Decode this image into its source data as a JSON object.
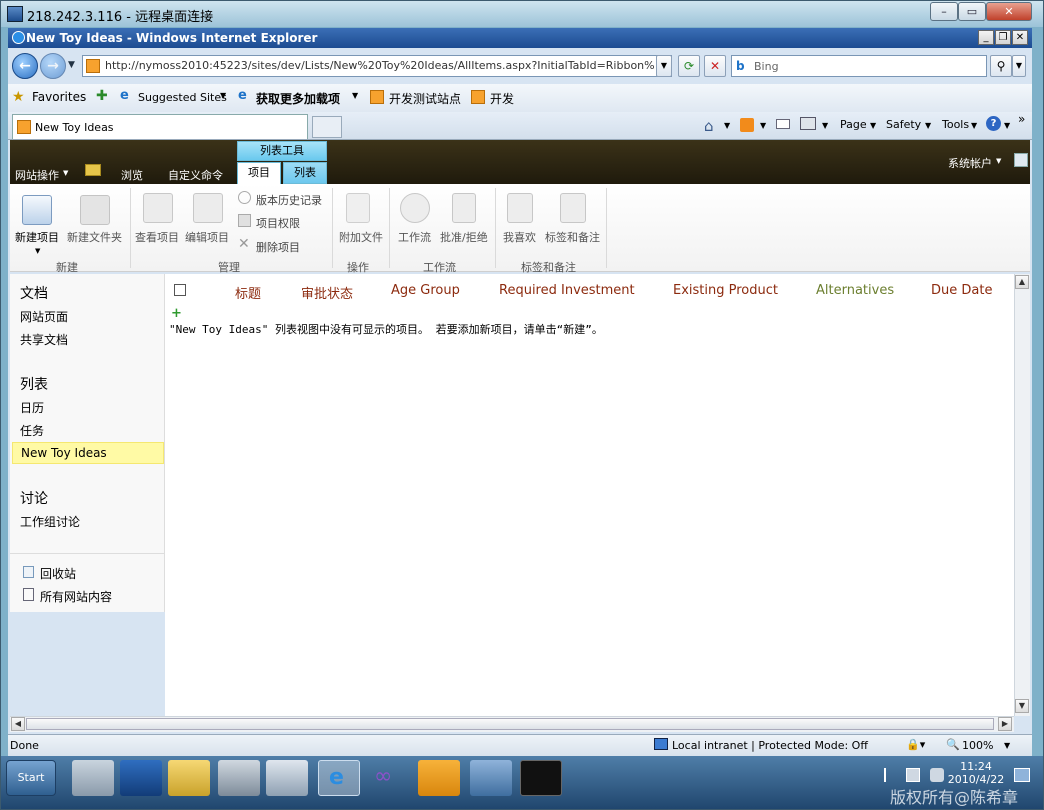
{
  "rdp": {
    "title": "218.242.3.116 - 远程桌面连接"
  },
  "ie": {
    "title": "New Toy Ideas - Windows Internet Explorer",
    "address": "http://nymoss2010:45223/sites/dev/Lists/New%20Toy%20Ideas/AllItems.aspx?InitialTabId=Ribbon%2EListItem&",
    "search_placeholder": "Bing",
    "favorites": {
      "label": "Favorites",
      "suggested": "Suggested Sites",
      "more_addons": "获取更多加载项",
      "dev_site": "开发测试站点",
      "dev": "开发"
    },
    "tab_label": "New Toy Ideas",
    "commands": {
      "page": "Page",
      "safety": "Safety",
      "tools": "Tools"
    }
  },
  "sharepoint": {
    "site_actions": "网站操作",
    "browse": "浏览",
    "custom_commands": "自定义命令",
    "context_group": "列表工具",
    "tab_items": "项目",
    "tab_list": "列表",
    "user": "系统帐户",
    "ribbon": {
      "new_item": "新建项目",
      "new_folder": "新建文件夹",
      "view_item": "查看项目",
      "edit_item": "编辑项目",
      "version_history": "版本历史记录",
      "item_permissions": "项目权限",
      "delete_item": "删除项目",
      "attach_file": "附加文件",
      "workflows": "工作流",
      "approve_reject": "批准/拒绝",
      "i_like_it": "我喜欢",
      "tags_notes": "标签和备注",
      "groups": {
        "new": "新建",
        "manage": "管理",
        "actions": "操作",
        "workflow": "工作流",
        "tags": "标签和备注"
      }
    },
    "leftnav": {
      "documents": "文档",
      "site_pages": "网站页面",
      "shared_documents": "共享文档",
      "lists": "列表",
      "calendar": "日历",
      "tasks": "任务",
      "new_toy_ideas": "New Toy Ideas",
      "discussions": "讨论",
      "team_discussion": "工作组讨论",
      "recycle_bin": "回收站",
      "all_content": "所有网站内容"
    },
    "columns": [
      "标题",
      "审批状态",
      "Age Group",
      "Required Investment",
      "Existing Product",
      "Alternatives",
      "Due Date"
    ],
    "empty_message": "\"New Toy Ideas\" 列表视图中没有可显示的项目。 若要添加新项目，请单击“新建”。"
  },
  "status": {
    "done": "Done",
    "zone": "Local intranet | Protected Mode: Off",
    "zoom": "100%"
  },
  "taskbar": {
    "start": "Start",
    "time": "11:24",
    "date": "2010/4/22"
  },
  "watermark": "版权所有@陈希章",
  "colors": {
    "accent_orange": "#8c2a0e",
    "accent_green": "#6c7f30",
    "ribbon_tab": "#6ac9ee",
    "selected_nav": "#fffaa5"
  }
}
